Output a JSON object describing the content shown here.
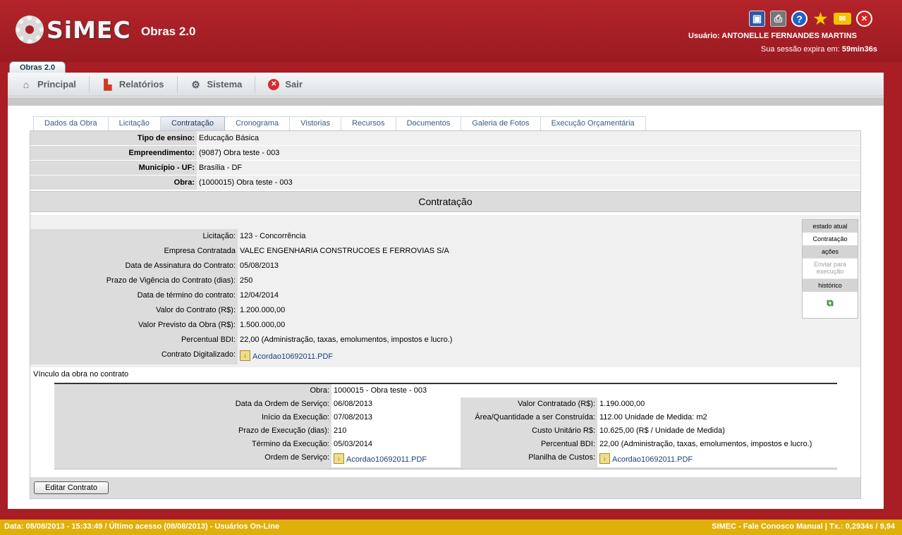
{
  "header": {
    "logo_text": "SiMEC",
    "app_title": "Obras 2.0",
    "user_label": "Usuário: ANTONELLE FERNANDES MARTINS",
    "session_label": "Sua sessão expira em:",
    "session_time": "59min36s"
  },
  "module_tab": "Obras 2.0",
  "menu": [
    {
      "label": "Principal",
      "icon": "home-icon"
    },
    {
      "label": "Relatórios",
      "icon": "chart-icon"
    },
    {
      "label": "Sistema",
      "icon": "gear-icon"
    },
    {
      "label": "Sair",
      "icon": "exit-icon"
    }
  ],
  "tabs": [
    "Dados da Obra",
    "Licitação",
    "Contratação",
    "Cronograma",
    "Vistorias",
    "Recursos",
    "Documentos",
    "Galeria de Fotos",
    "Execução Orçamentária"
  ],
  "active_tab": "Contratação",
  "obra_info": {
    "tipo_ensino_label": "Tipo de ensino:",
    "tipo_ensino": "Educação Básica",
    "empreendimento_label": "Empreendimento:",
    "empreendimento": "(9087) Obra teste - 003",
    "municipio_label": "Município - UF:",
    "municipio": "Brasília - DF",
    "obra_label": "Obra:",
    "obra": "(1000015) Obra teste - 003"
  },
  "section_title": "Contratação",
  "contract": {
    "licitacao_label": "Licitação:",
    "licitacao": "123 - Concorrência",
    "empresa_label": "Empresa Contratada",
    "empresa": "VALEC ENGENHARIA CONSTRUCOES E FERROVIAS S/A",
    "assinatura_label": "Data de Assinatura do Contrato:",
    "assinatura": "05/08/2013",
    "prazo_label": "Prazo de Vigência do Contrato (dias):",
    "prazo": "250",
    "termino_label": "Data de término do contrato:",
    "termino": "12/04/2014",
    "valor_label": "Valor do Contrato (R$):",
    "valor": "1.200.000,00",
    "previsto_label": "Valor Previsto da Obra (R$):",
    "previsto": "1.500.000,00",
    "bdi_label": "Percentual BDI:",
    "bdi": "22,00 (Administração, taxas, emolumentos, impostos e lucro.)",
    "digitalizado_label": "Contrato Digitalizado:",
    "digitalizado_file": "Acordao10692011.PDF"
  },
  "workflow": {
    "estado_label": "estado atual",
    "estado": "Contratação",
    "acoes_label": "ações",
    "acao": "Enviar para execução",
    "historico_label": "histórico"
  },
  "vinculo_label": "Vínculo da obra no contrato",
  "vinculo": {
    "obra_label": "Obra:",
    "obra": "1000015 - Obra teste - 003",
    "ordem_data_label": "Data da Ordem de Serviço:",
    "ordem_data": "06/08/2013",
    "inicio_label": "Início da Execução:",
    "inicio": "07/08/2013",
    "prazo_exec_label": "Prazo de Execução (dias):",
    "prazo_exec": "210",
    "termino_exec_label": "Término da Execução:",
    "termino_exec": "05/03/2014",
    "ordem_servico_label": "Ordem de Serviço:",
    "ordem_servico_file": "Acordao10692011.PDF",
    "valor_contratado_label": "Valor Contratado (R$):",
    "valor_contratado": "1.190.000,00",
    "area_label": "Área/Quantidade a ser Construída:",
    "area": "112.00  Unidade de Medida: m2",
    "custo_label": "Custo Unitário R$:",
    "custo": "10.625,00 (R$ / Unidade de Medida)",
    "bdi_label": "Percentual BDI:",
    "bdi": "22,00 (Administração, taxas, emolumentos, impostos e lucro.)",
    "planilha_label": "Planilha de Custos:",
    "planilha_file": "Acordao10692011.PDF"
  },
  "edit_button": "Editar Contrato",
  "footer": {
    "left": "Data: 08/08/2013 - 15:33:49 / Último acesso (08/08/2013) - Usuários On-Line",
    "right": "SIMEC - Fale Conosco Manual    | Tx.: 0,2934s / 9,94"
  },
  "colors": {
    "brand_red": "#a81e24",
    "footer_gold": "#e0b00a",
    "link_blue": "#1e3e7e"
  }
}
